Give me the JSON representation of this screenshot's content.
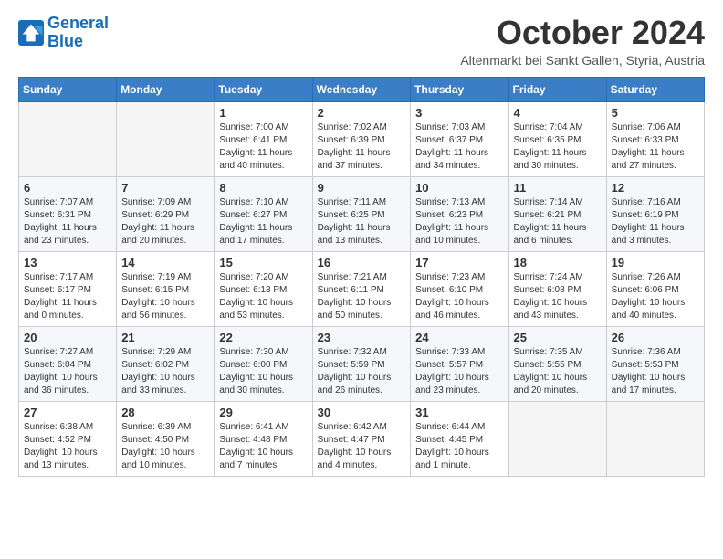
{
  "header": {
    "logo_line1": "General",
    "logo_line2": "Blue",
    "month": "October 2024",
    "location": "Altenmarkt bei Sankt Gallen, Styria, Austria"
  },
  "weekdays": [
    "Sunday",
    "Monday",
    "Tuesday",
    "Wednesday",
    "Thursday",
    "Friday",
    "Saturday"
  ],
  "weeks": [
    [
      {
        "day": "",
        "info": ""
      },
      {
        "day": "",
        "info": ""
      },
      {
        "day": "1",
        "info": "Sunrise: 7:00 AM\nSunset: 6:41 PM\nDaylight: 11 hours and 40 minutes."
      },
      {
        "day": "2",
        "info": "Sunrise: 7:02 AM\nSunset: 6:39 PM\nDaylight: 11 hours and 37 minutes."
      },
      {
        "day": "3",
        "info": "Sunrise: 7:03 AM\nSunset: 6:37 PM\nDaylight: 11 hours and 34 minutes."
      },
      {
        "day": "4",
        "info": "Sunrise: 7:04 AM\nSunset: 6:35 PM\nDaylight: 11 hours and 30 minutes."
      },
      {
        "day": "5",
        "info": "Sunrise: 7:06 AM\nSunset: 6:33 PM\nDaylight: 11 hours and 27 minutes."
      }
    ],
    [
      {
        "day": "6",
        "info": "Sunrise: 7:07 AM\nSunset: 6:31 PM\nDaylight: 11 hours and 23 minutes."
      },
      {
        "day": "7",
        "info": "Sunrise: 7:09 AM\nSunset: 6:29 PM\nDaylight: 11 hours and 20 minutes."
      },
      {
        "day": "8",
        "info": "Sunrise: 7:10 AM\nSunset: 6:27 PM\nDaylight: 11 hours and 17 minutes."
      },
      {
        "day": "9",
        "info": "Sunrise: 7:11 AM\nSunset: 6:25 PM\nDaylight: 11 hours and 13 minutes."
      },
      {
        "day": "10",
        "info": "Sunrise: 7:13 AM\nSunset: 6:23 PM\nDaylight: 11 hours and 10 minutes."
      },
      {
        "day": "11",
        "info": "Sunrise: 7:14 AM\nSunset: 6:21 PM\nDaylight: 11 hours and 6 minutes."
      },
      {
        "day": "12",
        "info": "Sunrise: 7:16 AM\nSunset: 6:19 PM\nDaylight: 11 hours and 3 minutes."
      }
    ],
    [
      {
        "day": "13",
        "info": "Sunrise: 7:17 AM\nSunset: 6:17 PM\nDaylight: 11 hours and 0 minutes."
      },
      {
        "day": "14",
        "info": "Sunrise: 7:19 AM\nSunset: 6:15 PM\nDaylight: 10 hours and 56 minutes."
      },
      {
        "day": "15",
        "info": "Sunrise: 7:20 AM\nSunset: 6:13 PM\nDaylight: 10 hours and 53 minutes."
      },
      {
        "day": "16",
        "info": "Sunrise: 7:21 AM\nSunset: 6:11 PM\nDaylight: 10 hours and 50 minutes."
      },
      {
        "day": "17",
        "info": "Sunrise: 7:23 AM\nSunset: 6:10 PM\nDaylight: 10 hours and 46 minutes."
      },
      {
        "day": "18",
        "info": "Sunrise: 7:24 AM\nSunset: 6:08 PM\nDaylight: 10 hours and 43 minutes."
      },
      {
        "day": "19",
        "info": "Sunrise: 7:26 AM\nSunset: 6:06 PM\nDaylight: 10 hours and 40 minutes."
      }
    ],
    [
      {
        "day": "20",
        "info": "Sunrise: 7:27 AM\nSunset: 6:04 PM\nDaylight: 10 hours and 36 minutes."
      },
      {
        "day": "21",
        "info": "Sunrise: 7:29 AM\nSunset: 6:02 PM\nDaylight: 10 hours and 33 minutes."
      },
      {
        "day": "22",
        "info": "Sunrise: 7:30 AM\nSunset: 6:00 PM\nDaylight: 10 hours and 30 minutes."
      },
      {
        "day": "23",
        "info": "Sunrise: 7:32 AM\nSunset: 5:59 PM\nDaylight: 10 hours and 26 minutes."
      },
      {
        "day": "24",
        "info": "Sunrise: 7:33 AM\nSunset: 5:57 PM\nDaylight: 10 hours and 23 minutes."
      },
      {
        "day": "25",
        "info": "Sunrise: 7:35 AM\nSunset: 5:55 PM\nDaylight: 10 hours and 20 minutes."
      },
      {
        "day": "26",
        "info": "Sunrise: 7:36 AM\nSunset: 5:53 PM\nDaylight: 10 hours and 17 minutes."
      }
    ],
    [
      {
        "day": "27",
        "info": "Sunrise: 6:38 AM\nSunset: 4:52 PM\nDaylight: 10 hours and 13 minutes."
      },
      {
        "day": "28",
        "info": "Sunrise: 6:39 AM\nSunset: 4:50 PM\nDaylight: 10 hours and 10 minutes."
      },
      {
        "day": "29",
        "info": "Sunrise: 6:41 AM\nSunset: 4:48 PM\nDaylight: 10 hours and 7 minutes."
      },
      {
        "day": "30",
        "info": "Sunrise: 6:42 AM\nSunset: 4:47 PM\nDaylight: 10 hours and 4 minutes."
      },
      {
        "day": "31",
        "info": "Sunrise: 6:44 AM\nSunset: 4:45 PM\nDaylight: 10 hours and 1 minute."
      },
      {
        "day": "",
        "info": ""
      },
      {
        "day": "",
        "info": ""
      }
    ]
  ]
}
